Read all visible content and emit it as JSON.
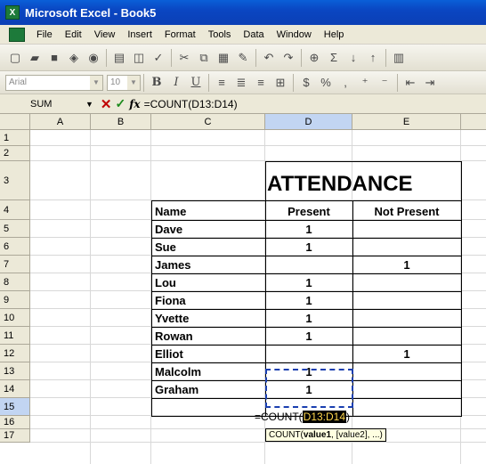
{
  "window": {
    "title": "Microsoft Excel - Book5",
    "logo": "X"
  },
  "menu": [
    "File",
    "Edit",
    "View",
    "Insert",
    "Format",
    "Tools",
    "Data",
    "Window",
    "Help"
  ],
  "toolbar_icons": [
    "new-icon",
    "open-icon",
    "save-icon",
    "permission-icon",
    "search-icon",
    "print-icon",
    "print-preview-icon",
    "spelling-icon",
    "cut-icon",
    "copy-icon",
    "paste-icon",
    "format-painter-icon",
    "undo-icon",
    "redo-icon",
    "hyperlink-icon",
    "autosum-icon",
    "sort-ascending-icon",
    "sort-descending-icon",
    "chart-icon"
  ],
  "format": {
    "font": "Arial",
    "size": "10"
  },
  "formula_bar": {
    "name_box": "SUM",
    "fx": "fx",
    "formula": "=COUNT(D13:D14)"
  },
  "columns": [
    "A",
    "B",
    "C",
    "D",
    "E"
  ],
  "rows": [
    "1",
    "2",
    "3",
    "4",
    "5",
    "6",
    "7",
    "8",
    "9",
    "10",
    "11",
    "12",
    "13",
    "14",
    "15",
    "16",
    "17"
  ],
  "sheet": {
    "title": "ATTENDANCE",
    "headers": {
      "name": "Name",
      "present": "Present",
      "not_present": "Not Present"
    },
    "records": [
      {
        "name": "Dave",
        "present": "1",
        "not_present": ""
      },
      {
        "name": "Sue",
        "present": "1",
        "not_present": ""
      },
      {
        "name": "James",
        "present": "",
        "not_present": "1"
      },
      {
        "name": "Lou",
        "present": "1",
        "not_present": ""
      },
      {
        "name": "Fiona",
        "present": "1",
        "not_present": ""
      },
      {
        "name": "Yvette",
        "present": "1",
        "not_present": ""
      },
      {
        "name": "Rowan",
        "present": "1",
        "not_present": ""
      },
      {
        "name": "Elliot",
        "present": "",
        "not_present": "1"
      },
      {
        "name": "Malcolm",
        "present": "1",
        "not_present": ""
      },
      {
        "name": "Graham",
        "present": "1",
        "not_present": ""
      }
    ],
    "editing_cell": {
      "prefix": "=COUNT(",
      "range": "D13:D14",
      "suffix": ")"
    }
  },
  "tooltip": {
    "fn": "COUNT(",
    "arg1": "value1",
    "rest": ", [value2], ...)"
  },
  "colors": {
    "title_bar": "#0a46c2",
    "selection_header": "#c2d5f2",
    "marquee": "#1a3fb0",
    "tooltip_bg": "#ffffe1"
  }
}
